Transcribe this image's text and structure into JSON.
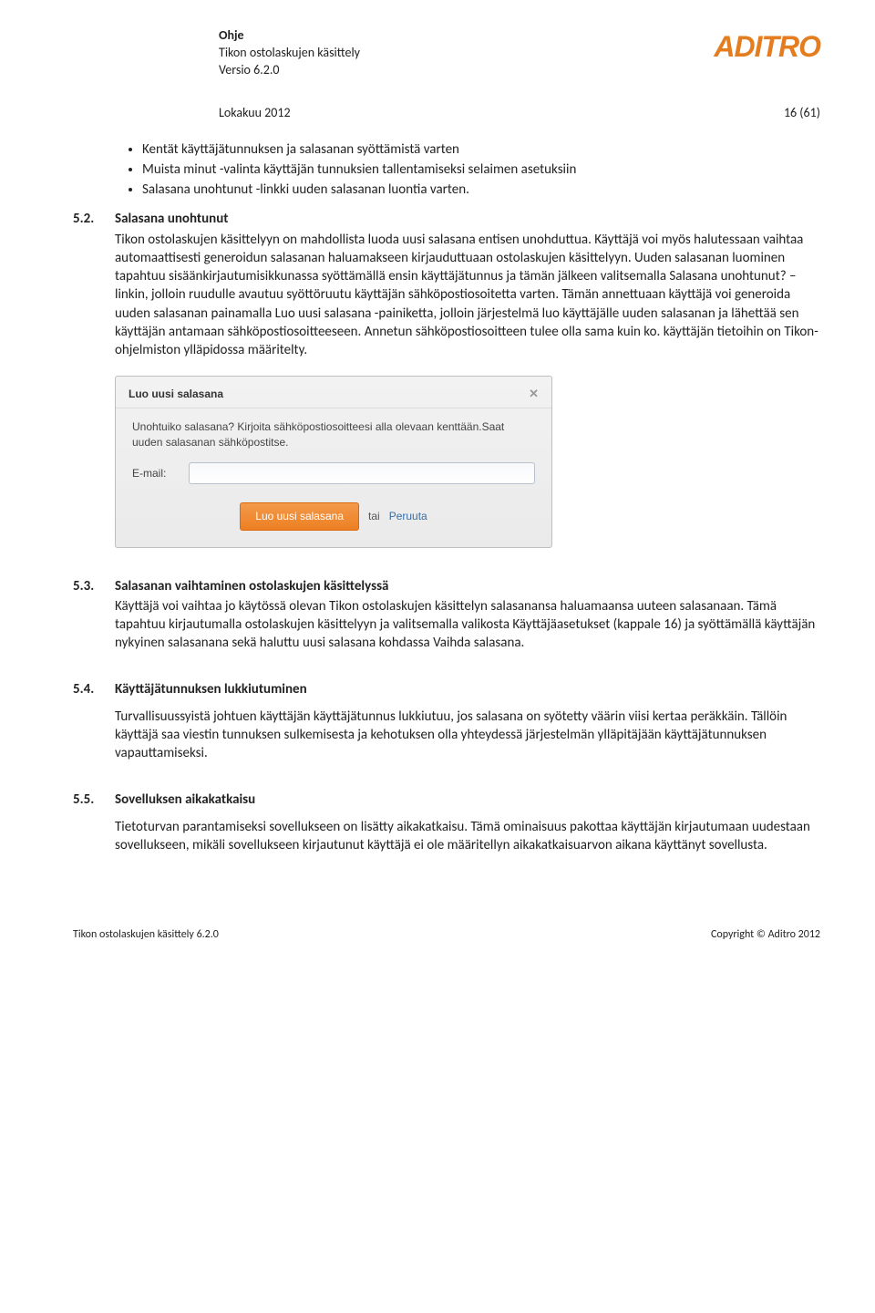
{
  "header": {
    "title": "Ohje",
    "subtitle": "Tikon ostolaskujen käsittely",
    "version": "Versio 6.2.0",
    "date": "Lokakuu 2012",
    "page": "16 (61)",
    "logo": "ADITRO"
  },
  "intro_bullets": [
    "Kentät käyttäjätunnuksen ja salasanan syöttämistä varten",
    "Muista minut -valinta käyttäjän tunnuksien tallentamiseksi selaimen asetuksiin",
    "Salasana unohtunut -linkki uuden salasanan luontia varten."
  ],
  "sections": {
    "s52": {
      "num": "5.2.",
      "title": "Salasana unohtunut",
      "text": "Tikon ostolaskujen käsittelyyn on mahdollista luoda uusi salasana entisen unohduttua. Käyttäjä voi myös halutessaan vaihtaa automaattisesti generoidun salasanan haluamakseen kirjauduttuaan ostolaskujen käsittelyyn. Uuden salasanan luominen tapahtuu sisäänkirjautumisikkunassa syöttämällä ensin käyttäjätunnus ja tämän jälkeen valitsemalla Salasana unohtunut? – linkin, jolloin ruudulle avautuu syöttöruutu käyttäjän sähköpostiosoitetta varten. Tämän annettuaan käyttäjä voi generoida uuden salasanan painamalla Luo uusi salasana -painiketta, jolloin järjestelmä luo käyttäjälle uuden salasanan ja lähettää sen käyttäjän antamaan sähköpostiosoitteeseen. Annetun sähköpostiosoitteen tulee olla sama kuin ko. käyttäjän tietoihin on Tikon-ohjelmiston ylläpidossa määritelty."
    },
    "s53": {
      "num": "5.3.",
      "title": "Salasanan vaihtaminen ostolaskujen käsittelyssä",
      "text": "Käyttäjä voi vaihtaa jo käytössä olevan Tikon ostolaskujen käsittelyn salasanansa haluamaansa uuteen salasanaan. Tämä tapahtuu kirjautumalla ostolaskujen käsittelyyn ja valitsemalla valikosta Käyttäjäasetukset (kappale 16) ja syöttämällä käyttäjän nykyinen salasanana sekä haluttu uusi salasana kohdassa Vaihda salasana."
    },
    "s54": {
      "num": "5.4.",
      "title": "Käyttäjätunnuksen lukkiutuminen",
      "text": "Turvallisuussyistä johtuen käyttäjän käyttäjätunnus lukkiutuu, jos salasana on syötetty väärin viisi kertaa peräkkäin. Tällöin käyttäjä saa viestin tunnuksen sulkemisesta ja kehotuksen olla yhteydessä järjestelmän ylläpitäjään käyttäjätunnuksen vapauttamiseksi."
    },
    "s55": {
      "num": "5.5.",
      "title": "Sovelluksen aikakatkaisu",
      "text": "Tietoturvan parantamiseksi sovellukseen on lisätty aikakatkaisu. Tämä ominaisuus pakottaa käyttäjän kirjautumaan uudestaan sovellukseen, mikäli sovellukseen kirjautunut käyttäjä ei ole määritellyn aikakatkaisuarvon aikana käyttänyt sovellusta."
    }
  },
  "dialog": {
    "title": "Luo uusi salasana",
    "desc": "Unohtuiko salasana? Kirjoita sähköpostiosoitteesi alla olevaan kenttään.Saat uuden salasanan sähköpostitse.",
    "email_label": "E-mail:",
    "primary": "Luo uusi salasana",
    "or": "tai",
    "cancel": "Peruuta"
  },
  "footer": {
    "left": "Tikon ostolaskujen käsittely 6.2.0",
    "right": "Copyright © Aditro 2012"
  }
}
